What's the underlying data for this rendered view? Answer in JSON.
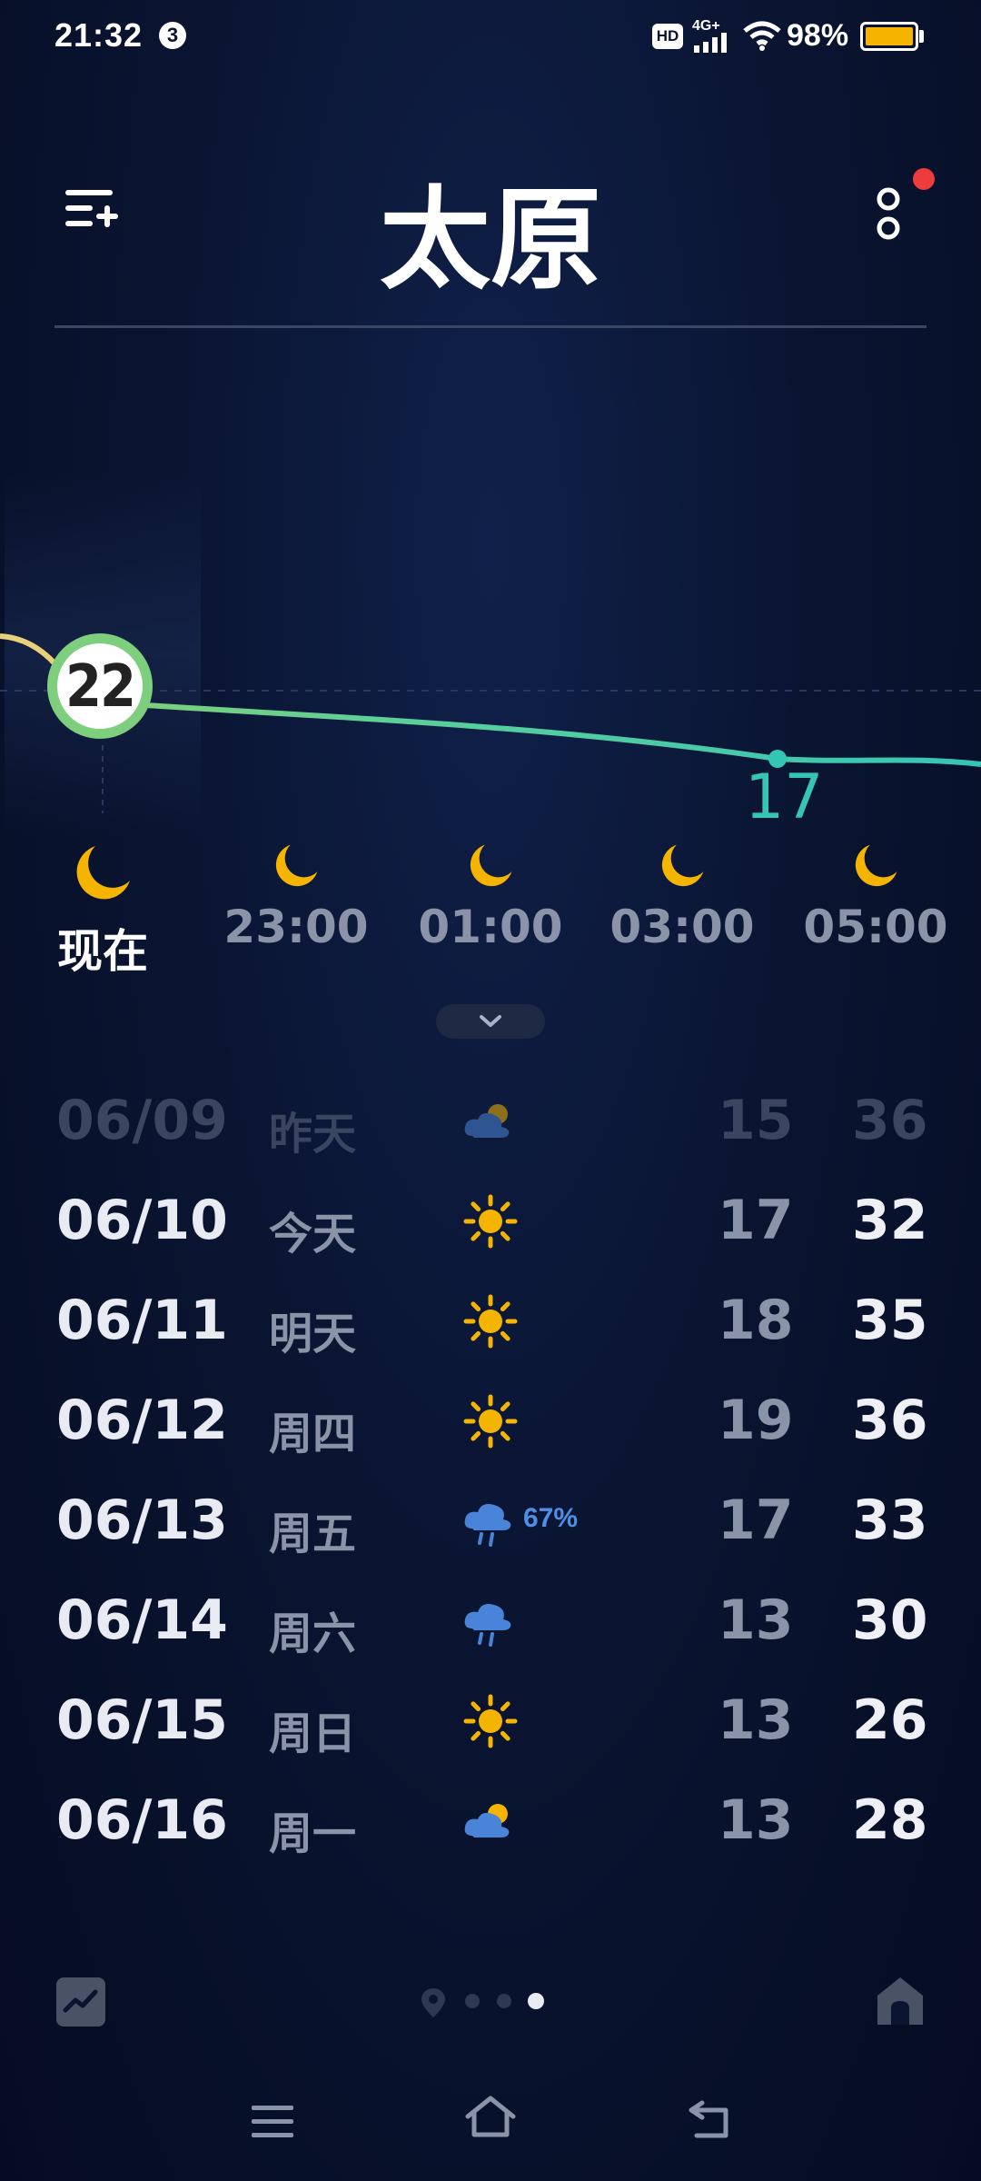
{
  "status_bar": {
    "time": "21:32",
    "notification_count": "3",
    "hd_label": "HD",
    "network": "4G+",
    "battery_percent": "98%",
    "battery_level": 0.98,
    "battery_color": "#f5b400"
  },
  "header": {
    "city": "太原",
    "menu_icon": "list-add-icon",
    "more_icon": "more-vertical-icon",
    "notification_dot_color": "#ee3b3b"
  },
  "hourly": {
    "current_temp": "22",
    "low_temp": "17",
    "hours": [
      {
        "label": "现在",
        "icon": "moon-icon"
      },
      {
        "label": "23:00",
        "icon": "moon-icon"
      },
      {
        "label": "01:00",
        "icon": "moon-icon"
      },
      {
        "label": "03:00",
        "icon": "moon-icon"
      },
      {
        "label": "05:00",
        "icon": "moon-icon"
      }
    ]
  },
  "daily": [
    {
      "date": "06/09",
      "day": "昨天",
      "icon": "partly-cloudy-icon",
      "low": "15",
      "high": "36",
      "past": true
    },
    {
      "date": "06/10",
      "day": "今天",
      "icon": "sun-icon",
      "low": "17",
      "high": "32"
    },
    {
      "date": "06/11",
      "day": "明天",
      "icon": "sun-icon",
      "low": "18",
      "high": "35"
    },
    {
      "date": "06/12",
      "day": "周四",
      "icon": "sun-icon",
      "low": "19",
      "high": "36"
    },
    {
      "date": "06/13",
      "day": "周五",
      "icon": "rain-icon",
      "precip": "67%",
      "low": "17",
      "high": "33"
    },
    {
      "date": "06/14",
      "day": "周六",
      "icon": "rain-icon",
      "low": "13",
      "high": "30"
    },
    {
      "date": "06/15",
      "day": "周日",
      "icon": "sun-icon",
      "low": "13",
      "high": "26"
    },
    {
      "date": "06/16",
      "day": "周一",
      "icon": "partly-cloudy-icon",
      "low": "13",
      "high": "28"
    }
  ],
  "bottom_bar": {
    "trend_icon": "trend-chart-icon",
    "home_icon": "home-city-icon",
    "pages": 3,
    "active_page": 3
  },
  "colors": {
    "background": "#0a1430",
    "accent_yellow": "#f5b400",
    "curve_teal": "#35c5b5",
    "curve_green": "#7dcf7d",
    "precip_blue": "#4f8fe8"
  }
}
